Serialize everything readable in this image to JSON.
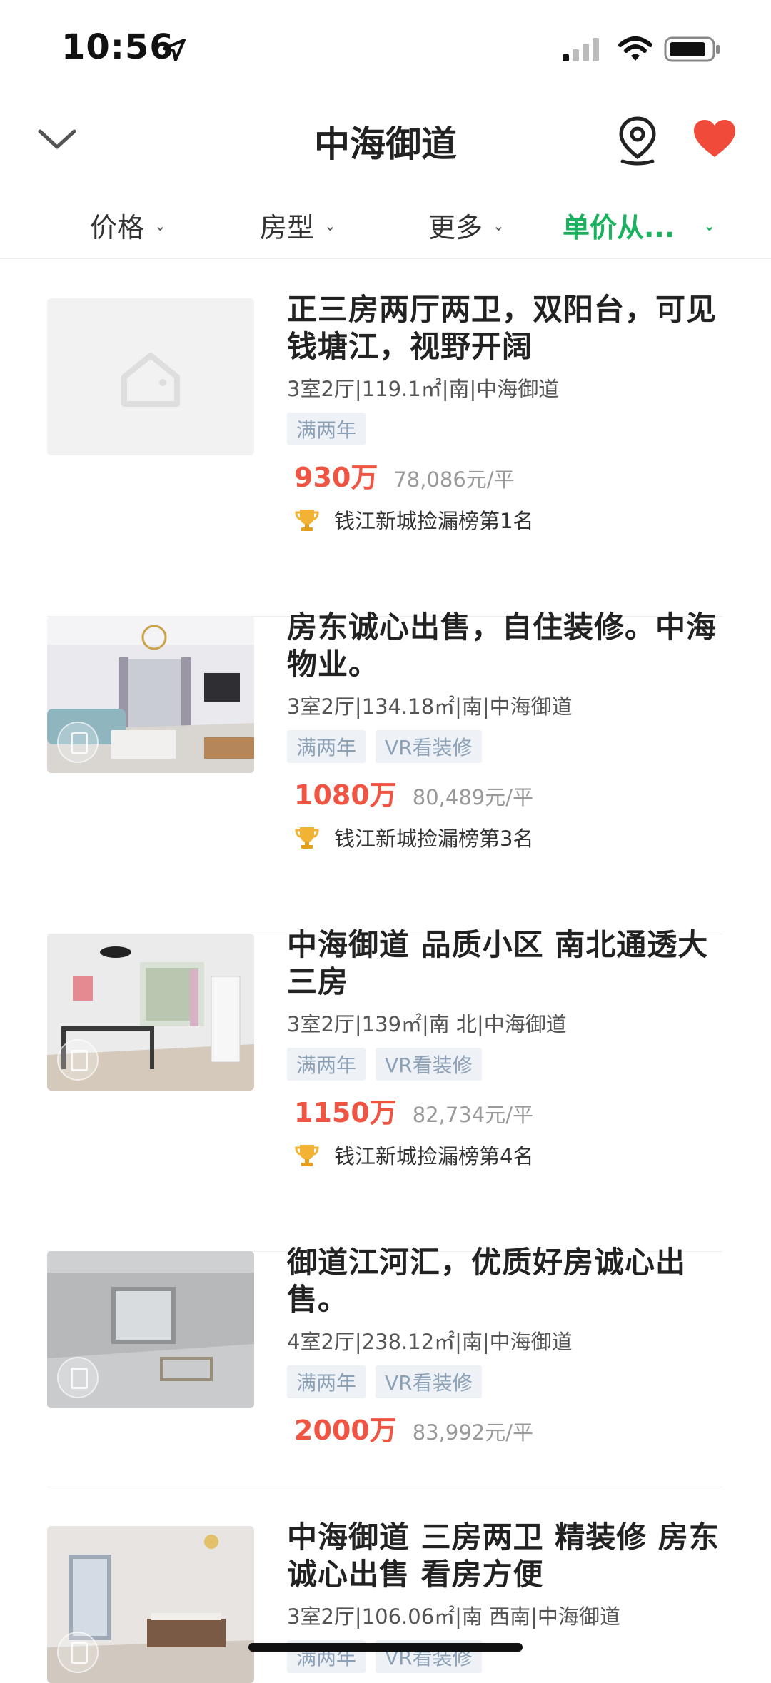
{
  "status_bar": {
    "time": "10:56"
  },
  "header": {
    "title": "中海御道"
  },
  "filters": [
    {
      "label": "价格"
    },
    {
      "label": "房型"
    },
    {
      "label": "更多"
    },
    {
      "label": "单价从..."
    }
  ],
  "listings": [
    {
      "title": "正三房两厅两卫，双阳台，可见钱塘江，视野开阔",
      "meta": "3室2厅|119.1㎡|南|中海御道",
      "tags": [
        "满两年"
      ],
      "price": "930万",
      "unit_price": "78,086元/平",
      "rank": "钱江新城捡漏榜第1名",
      "image": "placeholder"
    },
    {
      "title": "房东诚心出售，自住装修。中海物业。",
      "meta": "3室2厅|134.18㎡|南|中海御道",
      "tags": [
        "满两年",
        "VR看装修"
      ],
      "price": "1080万",
      "unit_price": "80,489元/平",
      "rank": "钱江新城捡漏榜第3名",
      "image": "living-room"
    },
    {
      "title": "中海御道 品质小区  南北通透大三房",
      "meta": "3室2厅|139㎡|南 北|中海御道",
      "tags": [
        "满两年",
        "VR看装修"
      ],
      "price": "1150万",
      "unit_price": "82,734元/平",
      "rank": "钱江新城捡漏榜第4名",
      "image": "bedroom"
    },
    {
      "title": "御道江河汇，优质好房诚心出售。",
      "meta": "4室2厅|238.12㎡|南|中海御道",
      "tags": [
        "满两年",
        "VR看装修"
      ],
      "price": "2000万",
      "unit_price": "83,992元/平",
      "rank": "",
      "image": "empty-room"
    },
    {
      "title": "中海御道  三房两卫  精装修  房东诚心出售 看房方便",
      "meta": "3室2厅|106.06㎡|南 西南|中海御道",
      "tags": [
        "满两年",
        "VR看装修"
      ],
      "price": "",
      "unit_price": "",
      "rank": "",
      "image": "dining-room"
    }
  ],
  "colors": {
    "accent_green": "#1bb25f",
    "price_red": "#f05443",
    "tag_blue": "#8da1b6",
    "favorite_red": "#f04b3a"
  }
}
